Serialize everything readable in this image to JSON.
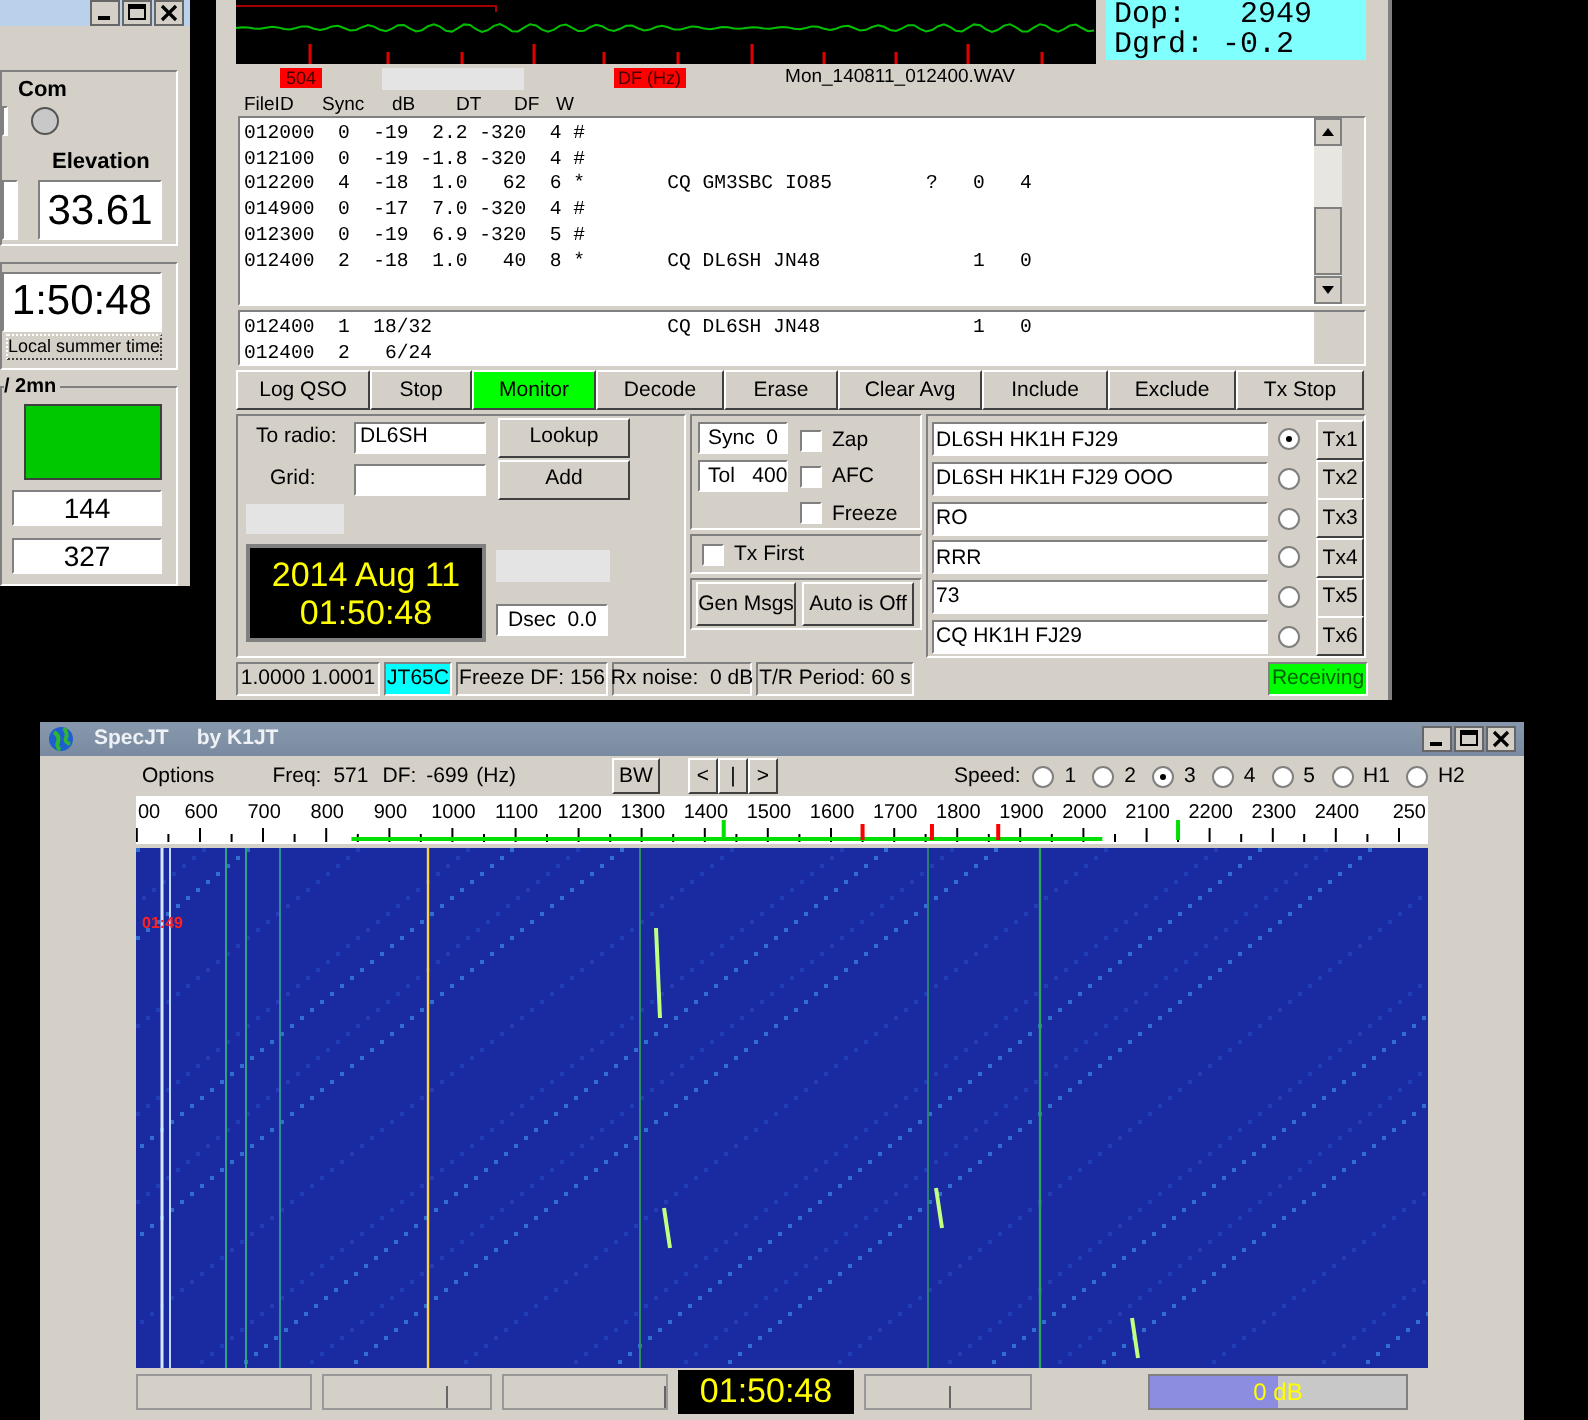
{
  "left_window": {
    "com_label": "Com",
    "elevation_label": "Elevation",
    "elevation": "33.61",
    "clock": "1:50:48",
    "summer_time_button": "Local summer time",
    "group_title": "/ 2mn",
    "values": [
      "144",
      "327"
    ]
  },
  "main_window": {
    "doppler": [
      "Dop:   2949",
      "Dgrd: -0.2"
    ],
    "marker": "504",
    "axis_label": "DF (Hz)",
    "file_name": "Mon_140811_012400.WAV",
    "columns": [
      "FileID",
      "Sync",
      "dB",
      "DT",
      "DF",
      "W"
    ],
    "decodes": [
      "012000  0  -19  2.2 -320  4 #",
      "012100  0  -19 -1.8 -320  4 #",
      "012200  4  -18  1.0   62  6 *       CQ GM3SBC IO85        ?   0   4",
      "014900  0  -17  7.0 -320  4 #",
      "012300  0  -19  6.9 -320  5 #",
      "012400  2  -18  1.0   40  8 *       CQ DL6SH JN48             1   0"
    ],
    "averages": [
      "012400  1  18/32                    CQ DL6SH JN48             1   0",
      "012400  2   6/24"
    ],
    "buttons": [
      {
        "label": "Log QSO",
        "on": false
      },
      {
        "label": "Stop",
        "on": false
      },
      {
        "label": "Monitor",
        "on": true
      },
      {
        "label": "Decode",
        "on": false
      },
      {
        "label": "Erase",
        "on": false
      },
      {
        "label": "Clear Avg",
        "on": false
      },
      {
        "label": "Include",
        "on": false
      },
      {
        "label": "Exclude",
        "on": false
      },
      {
        "label": "Tx Stop",
        "on": false
      }
    ],
    "to_radio": {
      "label": "To radio:",
      "value": "DL6SH"
    },
    "grid": {
      "label": "Grid:"
    },
    "lookup_button": "Lookup",
    "add_button": "Add",
    "date": "2014 Aug 11",
    "time": "01:50:48",
    "dsec": "Dsec  0.0",
    "sync": "Sync  0",
    "tol": "Tol   400",
    "options": [
      {
        "label": "Zap",
        "checked": false
      },
      {
        "label": "AFC",
        "checked": false
      },
      {
        "label": "Freeze",
        "checked": false
      }
    ],
    "tx_first": {
      "label": "Tx First",
      "checked": false
    },
    "gen_msgs_button": "Gen Msgs",
    "auto_button": "Auto is Off",
    "messages": [
      {
        "text": "DL6SH HK1H FJ29",
        "selected": true,
        "button": "Tx1"
      },
      {
        "text": "DL6SH HK1H FJ29 OOO",
        "selected": false,
        "button": "Tx2"
      },
      {
        "text": "RO",
        "selected": false,
        "button": "Tx3"
      },
      {
        "text": "RRR",
        "selected": false,
        "button": "Tx4"
      },
      {
        "text": "73",
        "selected": false,
        "button": "Tx5"
      },
      {
        "text": "CQ HK1H FJ29",
        "selected": false,
        "button": "Tx6"
      }
    ],
    "status_bar": [
      {
        "text": "1.0000 1.0001"
      },
      {
        "text": "JT65C",
        "color": "#00ffff"
      },
      {
        "text": "Freeze DF: 156"
      },
      {
        "text": "Rx noise:  0 dB"
      },
      {
        "text": "T/R Period: 60 s"
      },
      {
        "text": "Receiving",
        "color": "#00ff00"
      }
    ]
  },
  "spec_window": {
    "title": "SpecJT",
    "subtitle": "by K1JT",
    "options_menu": "Options",
    "freq_label": "Freq:",
    "freq": "571",
    "df_label": "DF:",
    "df": "-699",
    "unit": "(Hz)",
    "bw_button": "BW",
    "nav_buttons": [
      "<",
      "|",
      ">"
    ],
    "speed_label": "Speed:",
    "speeds": [
      {
        "label": "1",
        "selected": false
      },
      {
        "label": "2",
        "selected": false
      },
      {
        "label": "3",
        "selected": true
      },
      {
        "label": "4",
        "selected": false
      },
      {
        "label": "5",
        "selected": false
      },
      {
        "label": "H1",
        "selected": false
      },
      {
        "label": "H2",
        "selected": false
      }
    ],
    "scale_labels": [
      "00",
      "600",
      "700",
      "800",
      "900",
      "1000",
      "1100",
      "1200",
      "1300",
      "1400",
      "1500",
      "1600",
      "1700",
      "1800",
      "1900",
      "2000",
      "2100",
      "2200",
      "2300",
      "2400",
      "250"
    ],
    "time_mark": "01:49",
    "clock": "01:50:48",
    "gain": {
      "text": "0 dB",
      "level": 0.5
    }
  }
}
